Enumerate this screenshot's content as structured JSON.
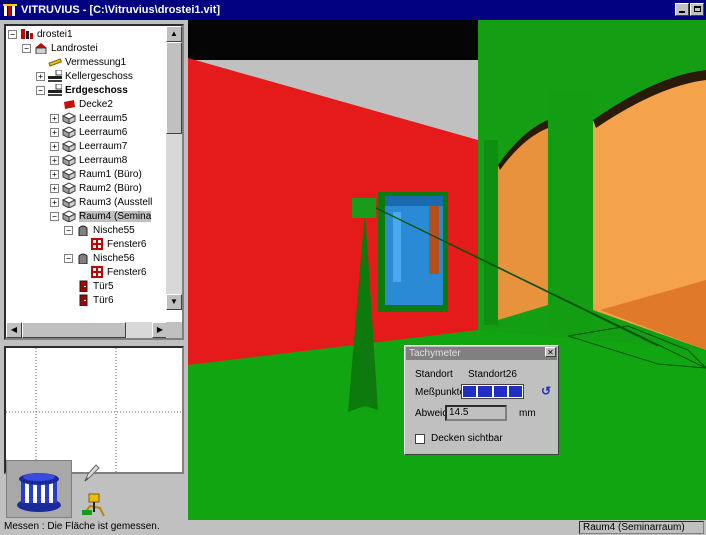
{
  "window": {
    "title": "VITRUVIUS - [C:\\Vitruvius\\drostei1.vit]"
  },
  "tree": {
    "items": [
      {
        "label": "drostei1",
        "depth": 0,
        "expander": "minus",
        "icon": "project-icon",
        "bold": false
      },
      {
        "label": "Landrostei",
        "depth": 1,
        "expander": "minus",
        "icon": "house-icon",
        "bold": false
      },
      {
        "label": "Vermessung1",
        "depth": 2,
        "expander": "none",
        "icon": "measure-icon",
        "bold": false
      },
      {
        "label": "Kellergeschoss",
        "depth": 2,
        "expander": "plus",
        "icon": "floor-icon",
        "bold": false
      },
      {
        "label": "Erdgeschoss",
        "depth": 2,
        "expander": "minus",
        "icon": "floor-icon",
        "bold": true
      },
      {
        "label": "Decke2",
        "depth": 3,
        "expander": "none",
        "icon": "ceiling-icon",
        "bold": false
      },
      {
        "label": "Leerraum5",
        "depth": 3,
        "expander": "plus",
        "icon": "room-icon",
        "bold": false
      },
      {
        "label": "Leerraum6",
        "depth": 3,
        "expander": "plus",
        "icon": "room-icon",
        "bold": false
      },
      {
        "label": "Leerraum7",
        "depth": 3,
        "expander": "plus",
        "icon": "room-icon",
        "bold": false
      },
      {
        "label": "Leerraum8",
        "depth": 3,
        "expander": "plus",
        "icon": "room-icon",
        "bold": false
      },
      {
        "label": "Raum1 (Büro)",
        "depth": 3,
        "expander": "plus",
        "icon": "room-icon",
        "bold": false
      },
      {
        "label": "Raum2 (Büro)",
        "depth": 3,
        "expander": "plus",
        "icon": "room-icon",
        "bold": false
      },
      {
        "label": "Raum3 (Ausstell",
        "depth": 3,
        "expander": "plus",
        "icon": "room-icon",
        "bold": false
      },
      {
        "label": "Raum4 (Semina",
        "depth": 3,
        "expander": "minus",
        "icon": "room-icon",
        "bold": false,
        "selected": true
      },
      {
        "label": "Nische55",
        "depth": 4,
        "expander": "minus",
        "icon": "niche-icon",
        "bold": false
      },
      {
        "label": "Fenster6",
        "depth": 5,
        "expander": "none",
        "icon": "window-icon",
        "bold": false
      },
      {
        "label": "Nische56",
        "depth": 4,
        "expander": "minus",
        "icon": "niche-icon",
        "bold": false
      },
      {
        "label": "Fenster6",
        "depth": 5,
        "expander": "none",
        "icon": "window-icon",
        "bold": false
      },
      {
        "label": "Tür5",
        "depth": 4,
        "expander": "none",
        "icon": "door-icon",
        "bold": false
      },
      {
        "label": "Tür6",
        "depth": 4,
        "expander": "none",
        "icon": "door-icon",
        "bold": false
      }
    ]
  },
  "dialog": {
    "title": "Tachymeter",
    "standort_label": "Standort",
    "standort_value": "Standort26",
    "messpunkte_label": "Meßpunkte",
    "messpunkte_filled": 4,
    "abweichung_label": "Abweichung",
    "abweichung_value": "14.5",
    "abweichung_unit": "mm",
    "decken_label": "Decken sichtbar",
    "decken_checked": false
  },
  "status": {
    "message": "Messen : Die Fläche ist gemessen.",
    "room": "Raum4 (Seminarraum)"
  },
  "colors": {
    "title_bar": "#000080",
    "floor": "#11a611",
    "red_wall": "#e51a1a",
    "orange_wall": "#f5a34a",
    "measure_blue": "#1f2fbf"
  }
}
